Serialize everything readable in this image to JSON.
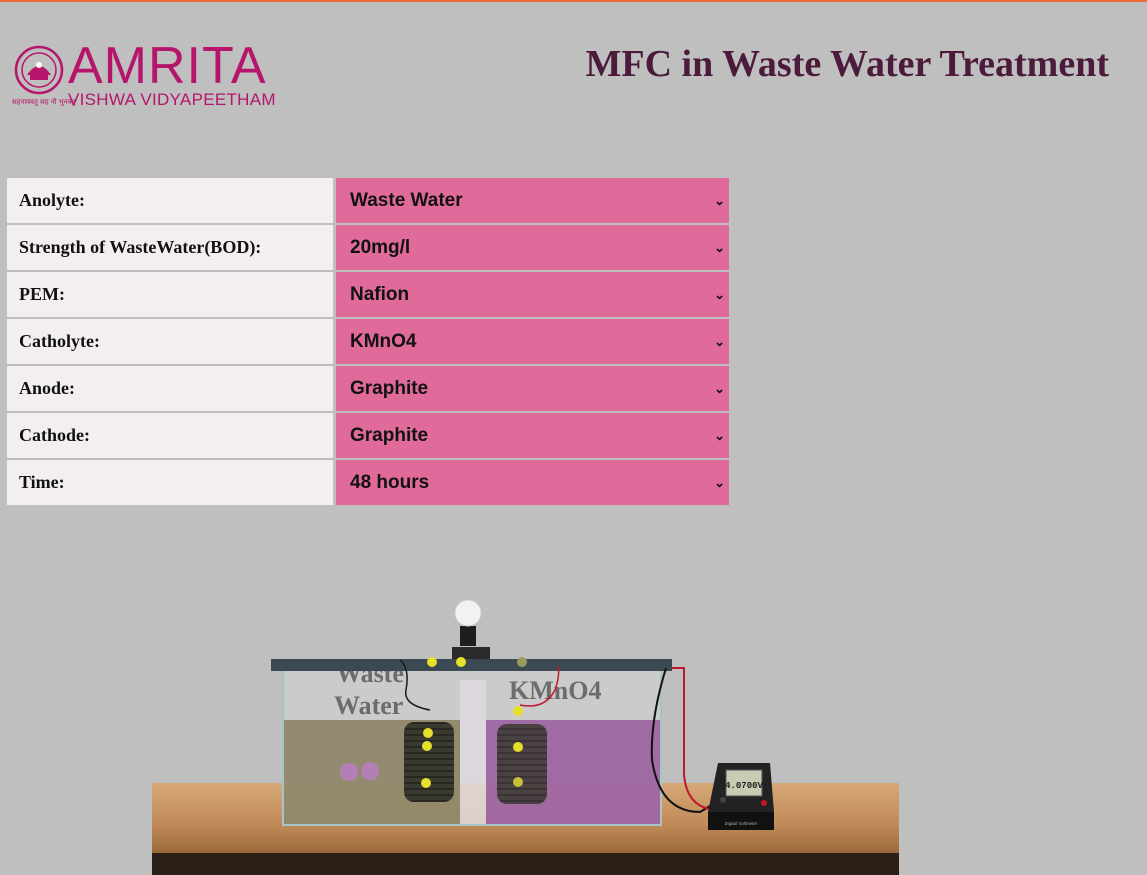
{
  "header": {
    "logo_brand": "AMRITA",
    "logo_subtitle": "VISHWA VIDYAPEETHAM",
    "logo_motto": "सहनाववतु सह नौ भुनक्तु",
    "page_title": "MFC in Waste Water Treatment"
  },
  "parameters": [
    {
      "label": "Anolyte:",
      "value": "Waste Water"
    },
    {
      "label": "Strength of WasteWater(BOD):",
      "value": "20mg/l"
    },
    {
      "label": "PEM:",
      "value": "Nafion"
    },
    {
      "label": "Catholyte:",
      "value": "KMnO4"
    },
    {
      "label": "Anode:",
      "value": "Graphite"
    },
    {
      "label": "Cathode:",
      "value": "Graphite"
    },
    {
      "label": "Time:",
      "value": "48 hours"
    }
  ],
  "apparatus": {
    "anode_chamber_label_line1": "Waste",
    "anode_chamber_label_line2": "Water",
    "cathode_chamber_label": "KMnO4",
    "voltmeter_reading": "4.0700V",
    "voltmeter_caption": "Digital Voltmeter",
    "colors": {
      "anolyte": "#8a8060",
      "catholyte": "#9a5aa0",
      "table_wood": "#c89464",
      "accent_pink": "#e06b9b"
    }
  }
}
